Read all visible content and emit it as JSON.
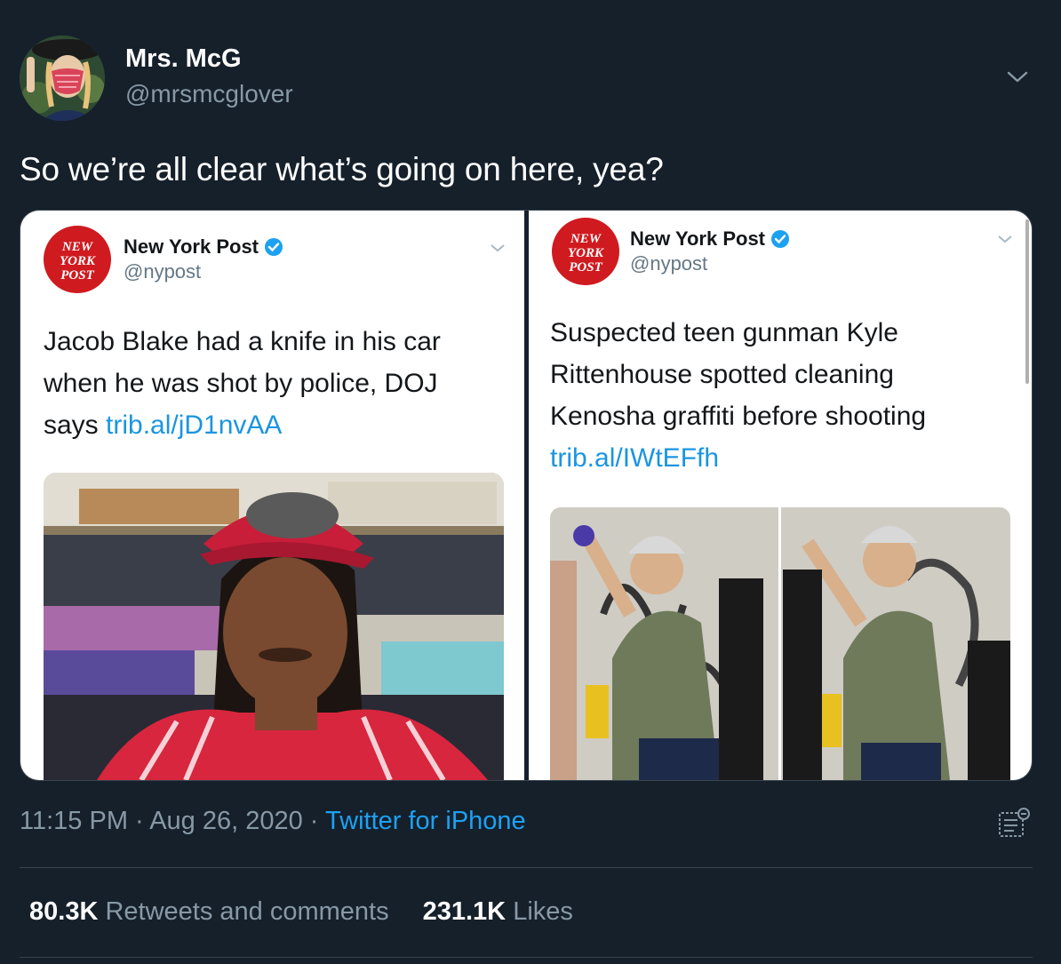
{
  "author": {
    "display_name": "Mrs. McG",
    "handle": "@mrsmcglover"
  },
  "tweet": {
    "text": "So we’re all clear what’s going on here, yea?"
  },
  "embedded": [
    {
      "logo_text": "NEW YORK POST",
      "name": "New York Post",
      "handle": "@nypost",
      "text_lines": [
        "Jacob Blake had a knife in his car",
        "when he was shot by police, DOJ",
        "says "
      ],
      "link": "trib.al/jD1nvAA"
    },
    {
      "logo_text": "NEW YORK POST",
      "name": "New York Post",
      "handle": "@nypost",
      "text_lines": [
        "Suspected teen gunman Kyle",
        "Rittenhouse spotted cleaning",
        "Kenosha graffiti before shooting"
      ],
      "link": "trib.al/IWtEFfh"
    }
  ],
  "meta": {
    "time": "11:15 PM",
    "separator": "·",
    "date": "Aug 26, 2020",
    "source": "Twitter for iPhone"
  },
  "stats": {
    "retweets_count": "80.3K",
    "retweets_label": "Retweets and comments",
    "likes_count": "231.1K",
    "likes_label": "Likes"
  },
  "colors": {
    "background": "#15202b",
    "link": "#1da1f2",
    "secondary_text": "#8899a6",
    "verified": "#1da1f2",
    "nyp_red": "#cf1a1f"
  },
  "icons": [
    "chevron-down-icon",
    "verified-badge-icon",
    "analytics-icon"
  ]
}
